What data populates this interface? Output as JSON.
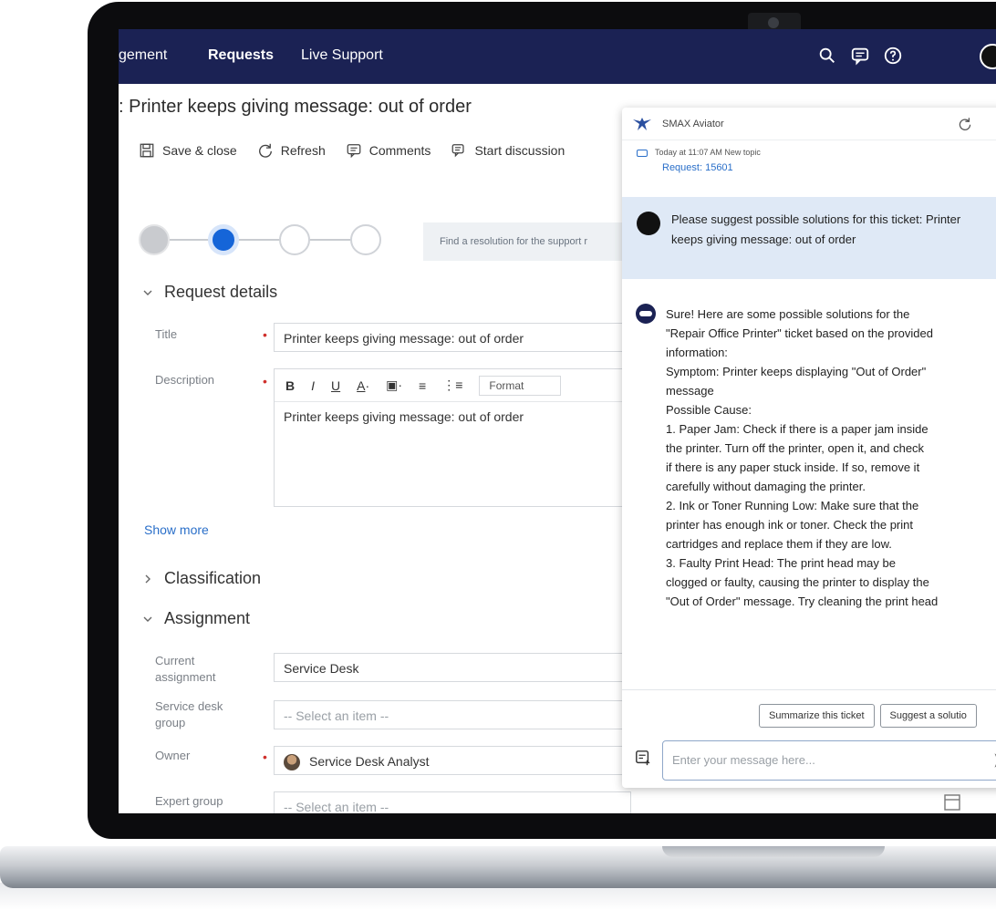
{
  "nav": {
    "items": [
      {
        "label": "gement"
      },
      {
        "label": "Requests"
      },
      {
        "label": "Live Support"
      }
    ],
    "icons": [
      "search-icon",
      "chat-icon",
      "help-icon"
    ]
  },
  "page": {
    "title": ": Printer keeps giving message: out of order"
  },
  "toolbar": {
    "save_close": "Save & close",
    "refresh": "Refresh",
    "comments": "Comments",
    "start_discussion": "Start discussion"
  },
  "stepper": {
    "hint": "Find a resolution for the support r"
  },
  "sections": {
    "request_details": "Request details",
    "classification": "Classification",
    "assignment": "Assignment"
  },
  "fields": {
    "title_label": "Title",
    "title_value": "Printer keeps giving message: out of order",
    "description_label": "Description",
    "description_value": "Printer keeps giving message: out of order",
    "editor_format": "Format",
    "show_more": "Show more",
    "current_assignment_label": "Current assignment",
    "current_assignment_value": "Service Desk",
    "service_desk_group_label": "Service desk group",
    "service_desk_group_placeholder": "-- Select an item --",
    "owner_label": "Owner",
    "owner_value": "Service Desk Analyst",
    "expert_group_label": "Expert group",
    "expert_group_placeholder": "-- Select an item --"
  },
  "aviator": {
    "title": "SMAX Aviator",
    "topic_time": "Today at 11:07 AM New topic",
    "topic_request": "Request: 15601",
    "user_message": [
      "Please suggest possible solutions for this ticket:",
      "Printer keeps giving message: out of order"
    ],
    "bot_message": [
      "Sure! Here are some possible solutions for the",
      "\"Repair Office Printer\" ticket based on the provided",
      "information:",
      "Symptom: Printer keeps displaying \"Out of Order\"",
      "message",
      "Possible Cause:",
      "1. Paper Jam: Check if there is a paper jam inside",
      "the printer. Turn off the printer, open it, and check",
      "if there is any paper stuck inside. If so, remove it",
      "carefully without damaging the printer.",
      "2. Ink or Toner Running Low: Make sure that the",
      "printer has enough ink or toner. Check the print",
      "cartridges and replace them if they are low.",
      "3. Faulty Print Head: The print head may be",
      "clogged or faulty, causing the printer to display the",
      "\"Out of Order\" message. Try cleaning the print head"
    ],
    "action_summarize": "Summarize this ticket",
    "action_suggest": "Suggest a solutio",
    "input_placeholder": "Enter your message here..."
  },
  "colors": {
    "nav_bg": "#1b2254",
    "accent": "#1565d8",
    "link": "#2a6fc9",
    "required": "#d0312d",
    "user_msg_bg": "#dfe9f6"
  }
}
